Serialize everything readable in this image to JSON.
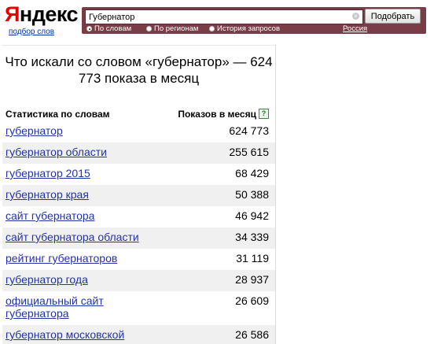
{
  "logo": {
    "first": "Я",
    "rest": "ндекс"
  },
  "logo_subtitle": "подбор слов",
  "search": {
    "value": "Губернатор",
    "clear_symbol": "×",
    "submit_label": "Подобрать",
    "modes": [
      {
        "label": "По словам",
        "selected": true
      },
      {
        "label": "По регионам",
        "selected": false
      },
      {
        "label": "История запросов",
        "selected": false
      }
    ],
    "region_label": "Россия"
  },
  "results": {
    "heading": "Что искали со словом «губернатор» — 624 773 показа в месяц",
    "col_phrases": "Статистика по словам",
    "col_counts": "Показов в месяц",
    "help_symbol": "?",
    "rows": [
      {
        "phrase": "губернатор",
        "count": "624 773"
      },
      {
        "phrase": "губернатор области",
        "count": "255 615"
      },
      {
        "phrase": "губернатор 2015",
        "count": "68 429"
      },
      {
        "phrase": "губернатор края",
        "count": "50 388"
      },
      {
        "phrase": "сайт губернатора",
        "count": "46 942"
      },
      {
        "phrase": "сайт губернатора области",
        "count": "34 339"
      },
      {
        "phrase": "рейтинг губернаторов",
        "count": "31 119"
      },
      {
        "phrase": "губернатор года",
        "count": "28 937"
      },
      {
        "phrase": "официальный сайт губернатора",
        "count": "26 609"
      },
      {
        "phrase": "губернатор московской",
        "count": "26 586"
      }
    ]
  },
  "colors": {
    "search_bar": "#7a3d47",
    "logo_red": "#e30000",
    "link_blue": "#2233aa",
    "row_alt": "#f0f0f0"
  }
}
